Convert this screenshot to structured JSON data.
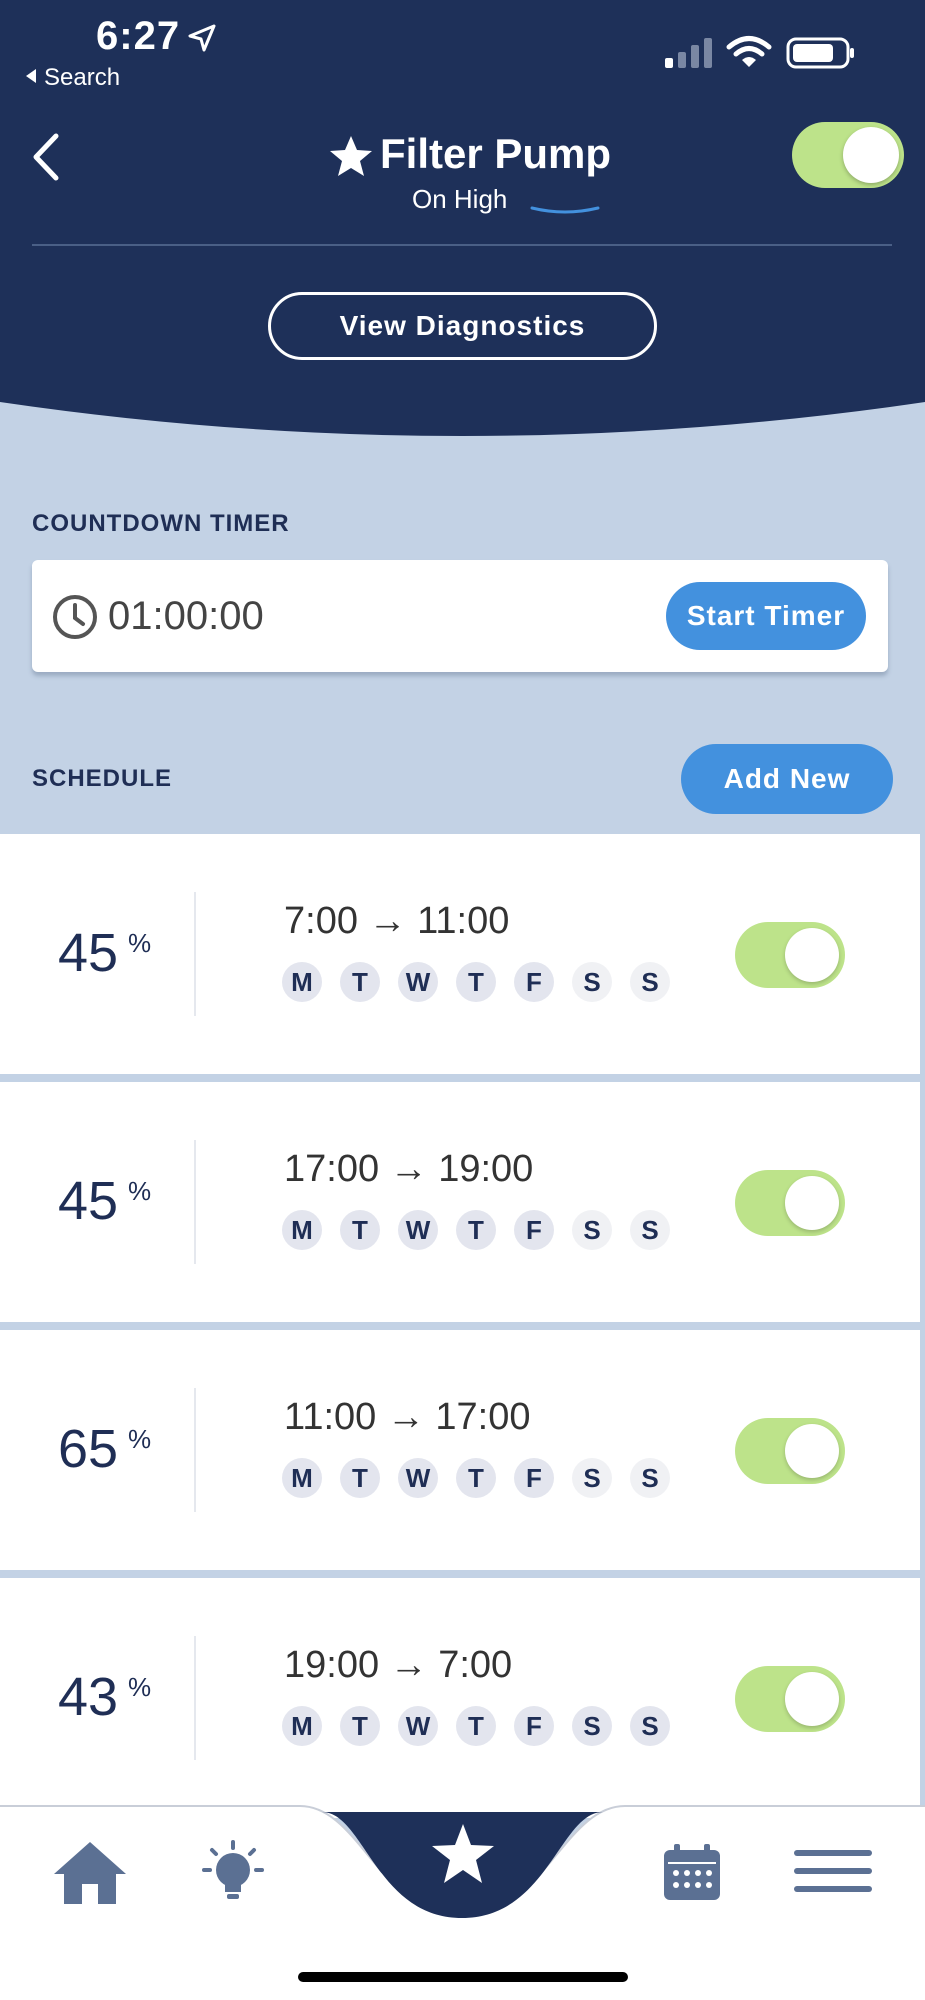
{
  "status_bar": {
    "time": "6:27",
    "back_app": "Search"
  },
  "header": {
    "title": "Filter Pump",
    "subtitle": "On High",
    "master_on": true,
    "diagnostics_label": "View Diagnostics"
  },
  "countdown": {
    "label": "COUNTDOWN TIMER",
    "value": "01:00:00",
    "start_label": "Start Timer"
  },
  "schedule": {
    "label": "SCHEDULE",
    "add_label": "Add New",
    "items": [
      {
        "percent": "45",
        "start": "7:00",
        "end": "11:00",
        "enabled": true,
        "days": [
          {
            "l": "M",
            "on": true
          },
          {
            "l": "T",
            "on": true
          },
          {
            "l": "W",
            "on": true
          },
          {
            "l": "T",
            "on": true
          },
          {
            "l": "F",
            "on": true
          },
          {
            "l": "S",
            "on": false
          },
          {
            "l": "S",
            "on": false
          }
        ]
      },
      {
        "percent": "45",
        "start": "17:00",
        "end": "19:00",
        "enabled": true,
        "days": [
          {
            "l": "M",
            "on": true
          },
          {
            "l": "T",
            "on": true
          },
          {
            "l": "W",
            "on": true
          },
          {
            "l": "T",
            "on": true
          },
          {
            "l": "F",
            "on": true
          },
          {
            "l": "S",
            "on": false
          },
          {
            "l": "S",
            "on": false
          }
        ]
      },
      {
        "percent": "65",
        "start": "11:00",
        "end": "17:00",
        "enabled": true,
        "days": [
          {
            "l": "M",
            "on": true
          },
          {
            "l": "T",
            "on": true
          },
          {
            "l": "W",
            "on": true
          },
          {
            "l": "T",
            "on": true
          },
          {
            "l": "F",
            "on": true
          },
          {
            "l": "S",
            "on": false
          },
          {
            "l": "S",
            "on": false
          }
        ]
      },
      {
        "percent": "43",
        "start": "19:00",
        "end": "7:00",
        "enabled": true,
        "days": [
          {
            "l": "M",
            "on": true
          },
          {
            "l": "T",
            "on": true
          },
          {
            "l": "W",
            "on": true
          },
          {
            "l": "T",
            "on": true
          },
          {
            "l": "F",
            "on": true
          },
          {
            "l": "S",
            "on": true
          },
          {
            "l": "S",
            "on": true
          }
        ]
      }
    ]
  },
  "percent_sign": "%",
  "arrow": "→",
  "tabs": [
    "home-icon",
    "lightbulb-icon",
    "star-icon",
    "calendar-icon",
    "menu-icon"
  ],
  "colors": {
    "header_bg": "#1e3059",
    "page_bg": "#c3d2e5",
    "accent_blue": "#4391de",
    "toggle_on": "#bde38a",
    "text_navy": "#1f2e55",
    "icon_slate": "#5b7093"
  }
}
